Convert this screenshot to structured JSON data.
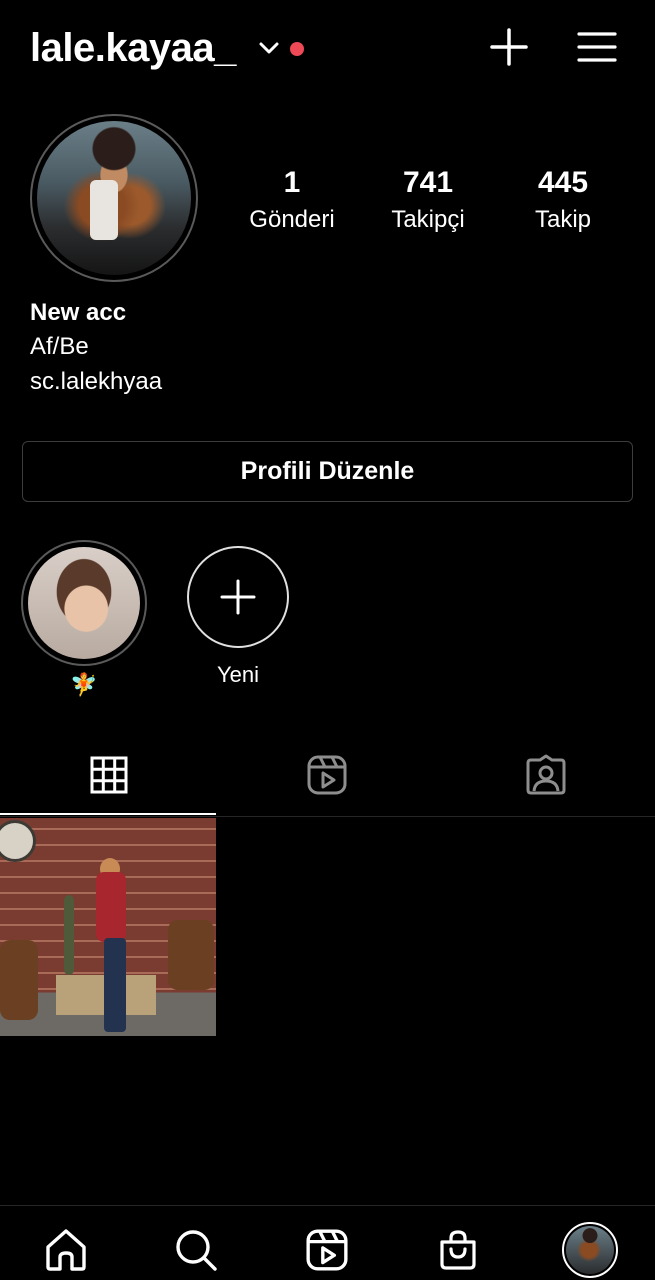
{
  "header": {
    "username": "lale.kayaa_",
    "dropdown_icon": "chevron-down-icon",
    "notification_color": "#ed4956",
    "add_icon": "plus-icon",
    "menu_icon": "hamburger-menu-icon"
  },
  "stats": [
    {
      "value": "1",
      "label": "Gönderi"
    },
    {
      "value": "741",
      "label": "Takipçi"
    },
    {
      "value": "445",
      "label": "Takip"
    }
  ],
  "bio": {
    "name": "New acc",
    "lines": [
      "Af/Be",
      "sc.lalekhyaa"
    ]
  },
  "edit_profile_label": "Profili Düzenle",
  "highlights": [
    {
      "label": "🧚"
    },
    {
      "label": "Yeni",
      "icon": "plus-icon"
    }
  ],
  "tabs": [
    {
      "name": "posts",
      "icon": "grid-icon",
      "active": true
    },
    {
      "name": "reels",
      "icon": "reels-icon",
      "active": false
    },
    {
      "name": "tagged",
      "icon": "tagged-user-icon",
      "active": false
    }
  ],
  "bottom_nav": [
    {
      "name": "home",
      "icon": "home-icon"
    },
    {
      "name": "search",
      "icon": "search-icon"
    },
    {
      "name": "reels",
      "icon": "reels-icon"
    },
    {
      "name": "shop",
      "icon": "shopping-bag-icon"
    },
    {
      "name": "profile",
      "icon": "avatar"
    }
  ],
  "colors": {
    "background": "#000000",
    "text": "#ffffff",
    "divider": "#262626",
    "button_border": "#3c3c3c"
  }
}
